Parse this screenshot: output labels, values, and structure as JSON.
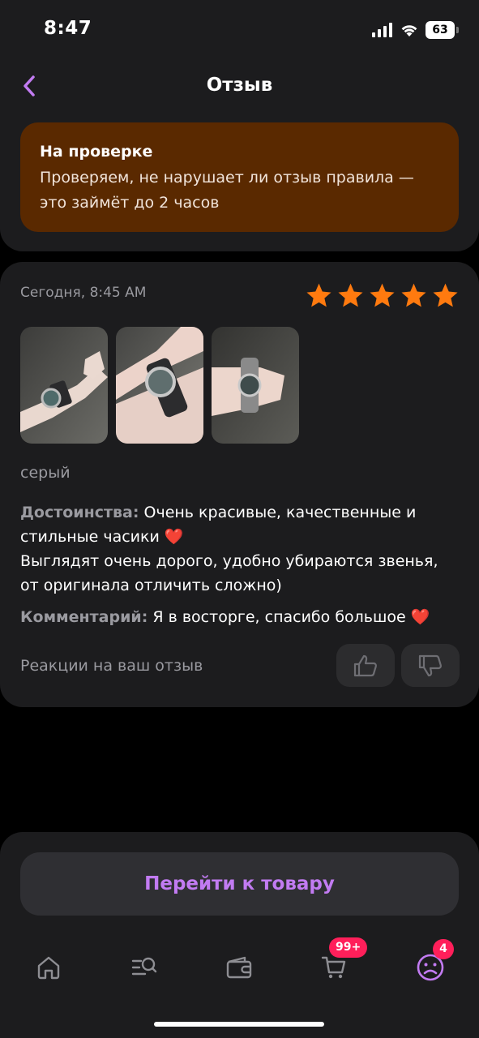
{
  "status_bar": {
    "time": "8:47",
    "battery": "63"
  },
  "header": {
    "title": "Отзыв"
  },
  "moderation": {
    "title": "На проверке",
    "text_line1": "Проверяем, не нарушает ли отзыв правила —",
    "text_line2": "это займёт до 2 часов"
  },
  "review": {
    "date": "Сегодня, 8:45 AM",
    "rating": 5,
    "variant": "серый",
    "pros_label": "Достоинства:",
    "pros_line1": "Очень красивые, качественные и",
    "pros_line2": "стильные часики",
    "pros_line3": "Выглядят очень дорого, удобно убираются звенья,",
    "pros_line4": "от оригинала отличить сложно)",
    "comment_label": "Комментарий:",
    "comment_text": "Я в восторге, спасибо большое",
    "heart_emoji": "❤️",
    "reactions_label": "Реакции на ваш отзыв"
  },
  "actions": {
    "goto_product": "Перейти к товару"
  },
  "tabbar": {
    "cart_badge": "99+",
    "profile_badge": "4"
  },
  "colors": {
    "accent": "#c27bf2",
    "star": "#ff7a0f",
    "banner": "#5a2900",
    "badge": "#ff1f5a"
  }
}
